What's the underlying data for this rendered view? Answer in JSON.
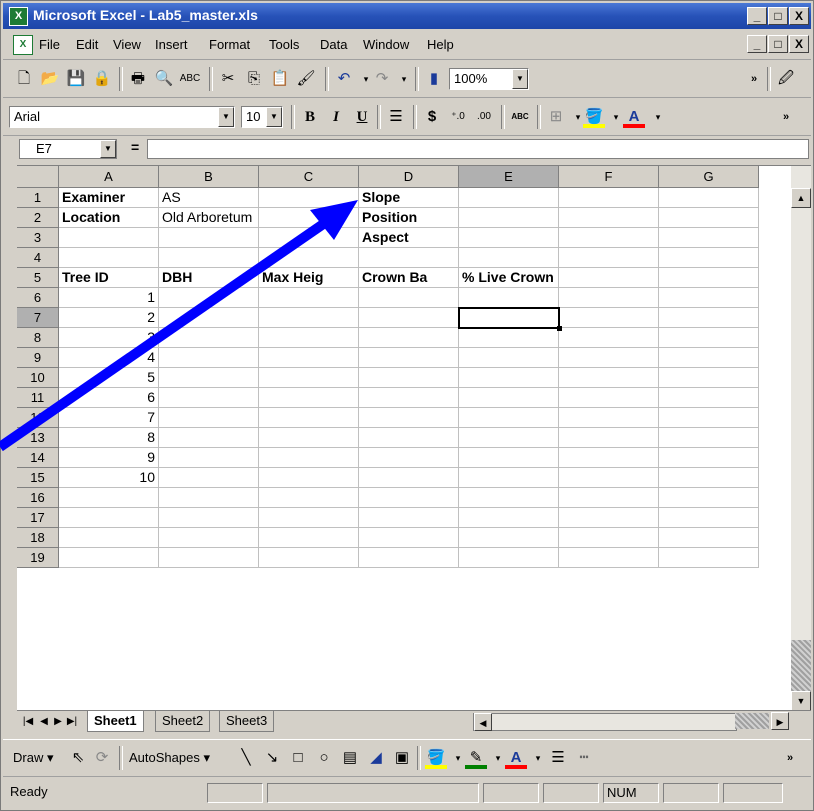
{
  "window": {
    "title": "Microsoft Excel - Lab5_master.xls",
    "min_glyph": "_",
    "max_glyph": "□",
    "close_glyph": "X",
    "restore_glyph": "□"
  },
  "menu": [
    "File",
    "Edit",
    "View",
    "Insert",
    "Format",
    "Tools",
    "Data",
    "Window",
    "Help"
  ],
  "toolbar": {
    "zoom": "100%",
    "font_name": "Arial",
    "font_size": "10",
    "bold_label": "B",
    "italic_label": "I",
    "underline_label": "U",
    "currency_label": "$",
    "increase_decimal": "⁺.0",
    "decrease_decimal": ".00",
    "abc_label": "ABC",
    "font_color_label": "A"
  },
  "formula_bar": {
    "name_box": "E7",
    "equals": "=",
    "formula": ""
  },
  "columns": [
    "A",
    "B",
    "C",
    "D",
    "E",
    "F",
    "G"
  ],
  "rows": [
    "1",
    "2",
    "3",
    "4",
    "5",
    "6",
    "7",
    "8",
    "9",
    "10",
    "11",
    "12",
    "13",
    "14",
    "15",
    "16",
    "17",
    "18",
    "19"
  ],
  "cells": {
    "A1": "Examiner",
    "B1": "AS",
    "D1": "Slope",
    "A2": "Location",
    "B2": "Old Arboretum",
    "D2": "Position",
    "D3": "Aspect",
    "A5": "Tree ID",
    "B5": "DBH",
    "C5": "Max Heig",
    "D5": "Crown Ba",
    "E5": "% Live Crown",
    "A6": "1",
    "A7": "2",
    "A8": "3",
    "A9": "4",
    "A10": "5",
    "A11": "6",
    "A12": "7",
    "A13": "8",
    "A14": "9",
    "A15": "10"
  },
  "sheet_tabs": [
    "Sheet1",
    "Sheet2",
    "Sheet3"
  ],
  "active_sheet": "Sheet1",
  "drawing_toolbar": {
    "draw_label": "Draw",
    "autoshapes_label": "AutoShapes"
  },
  "status": {
    "ready": "Ready",
    "num": "NUM"
  },
  "colors": {
    "titlebar": "#2752b8",
    "arrow": "#0000ff",
    "excel_green": "#1e7b35"
  }
}
